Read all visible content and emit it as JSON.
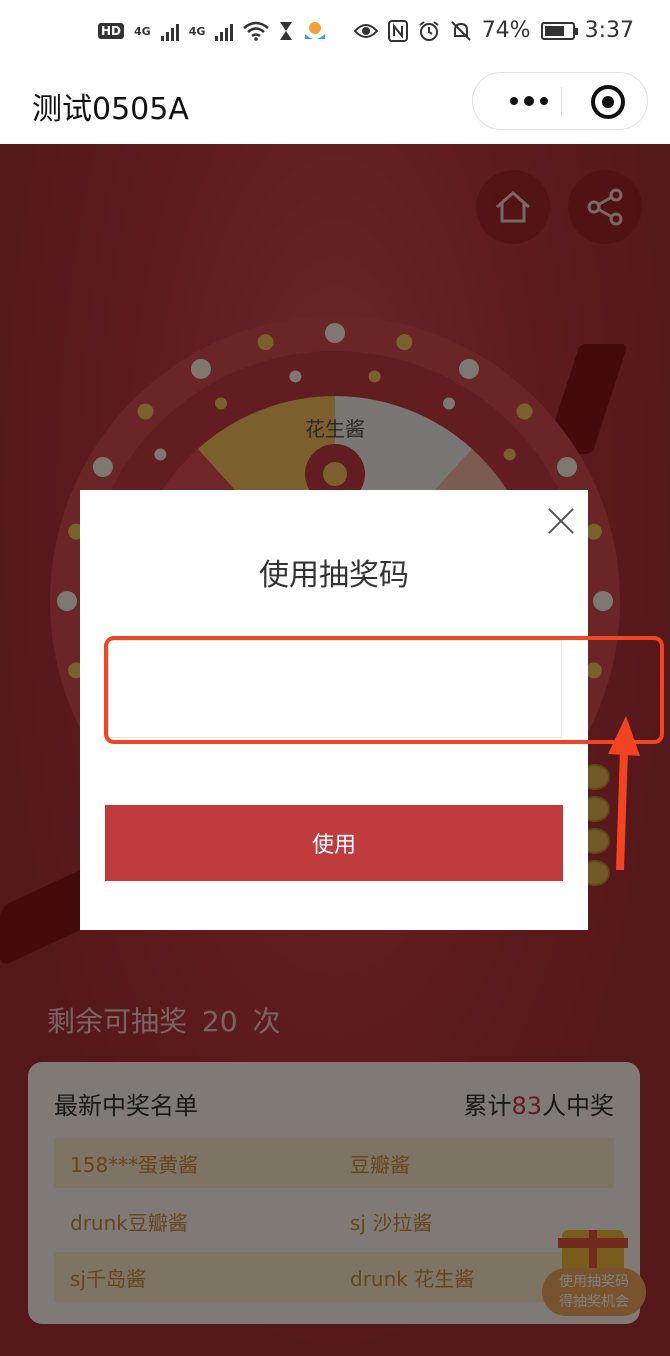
{
  "status_bar": {
    "hd": "HD",
    "net1": "4G",
    "net2": "4G",
    "battery": "74%",
    "time": "3:37",
    "battery_level": 0.74,
    "icons": [
      "signal-icon",
      "wifi-icon",
      "hourglass-icon",
      "app-icon",
      "eye-icon",
      "nfc-icon",
      "alarm-icon",
      "mute-icon",
      "battery-icon"
    ]
  },
  "navbar": {
    "title": "测试0505A",
    "icons": [
      "more-icon",
      "close-mini-program-icon"
    ]
  },
  "page": {
    "icons": [
      "home-icon",
      "share-icon"
    ],
    "wheel": {
      "segments": [
        "花生酱"
      ],
      "colors": [
        "#f6c15b",
        "#f3efe9",
        "#f9b7a3"
      ]
    },
    "remaining": {
      "prefix": "剩余可抽奖",
      "count": "20",
      "suffix": "次"
    },
    "winners": {
      "title": "最新中奖名单",
      "total_prefix": "累计",
      "total_count": "83",
      "total_suffix": "人中奖",
      "rows": [
        [
          "158***蛋黄酱",
          "豆瓣酱"
        ],
        [
          "drunk豆瓣酱",
          "sj 沙拉酱"
        ],
        [
          "sj千岛酱",
          "drunk 花生酱"
        ]
      ]
    },
    "fab": {
      "line1": "使用抽奖码",
      "line2": "得抽奖机会"
    }
  },
  "modal": {
    "title": "使用抽奖码",
    "input_value": "",
    "input_placeholder": "",
    "button": "使用"
  },
  "colors": {
    "background_red": "#b93a3e",
    "button_red": "#c03b3e",
    "highlight": "#f3441f",
    "winner_gold": "#c98c3c"
  }
}
